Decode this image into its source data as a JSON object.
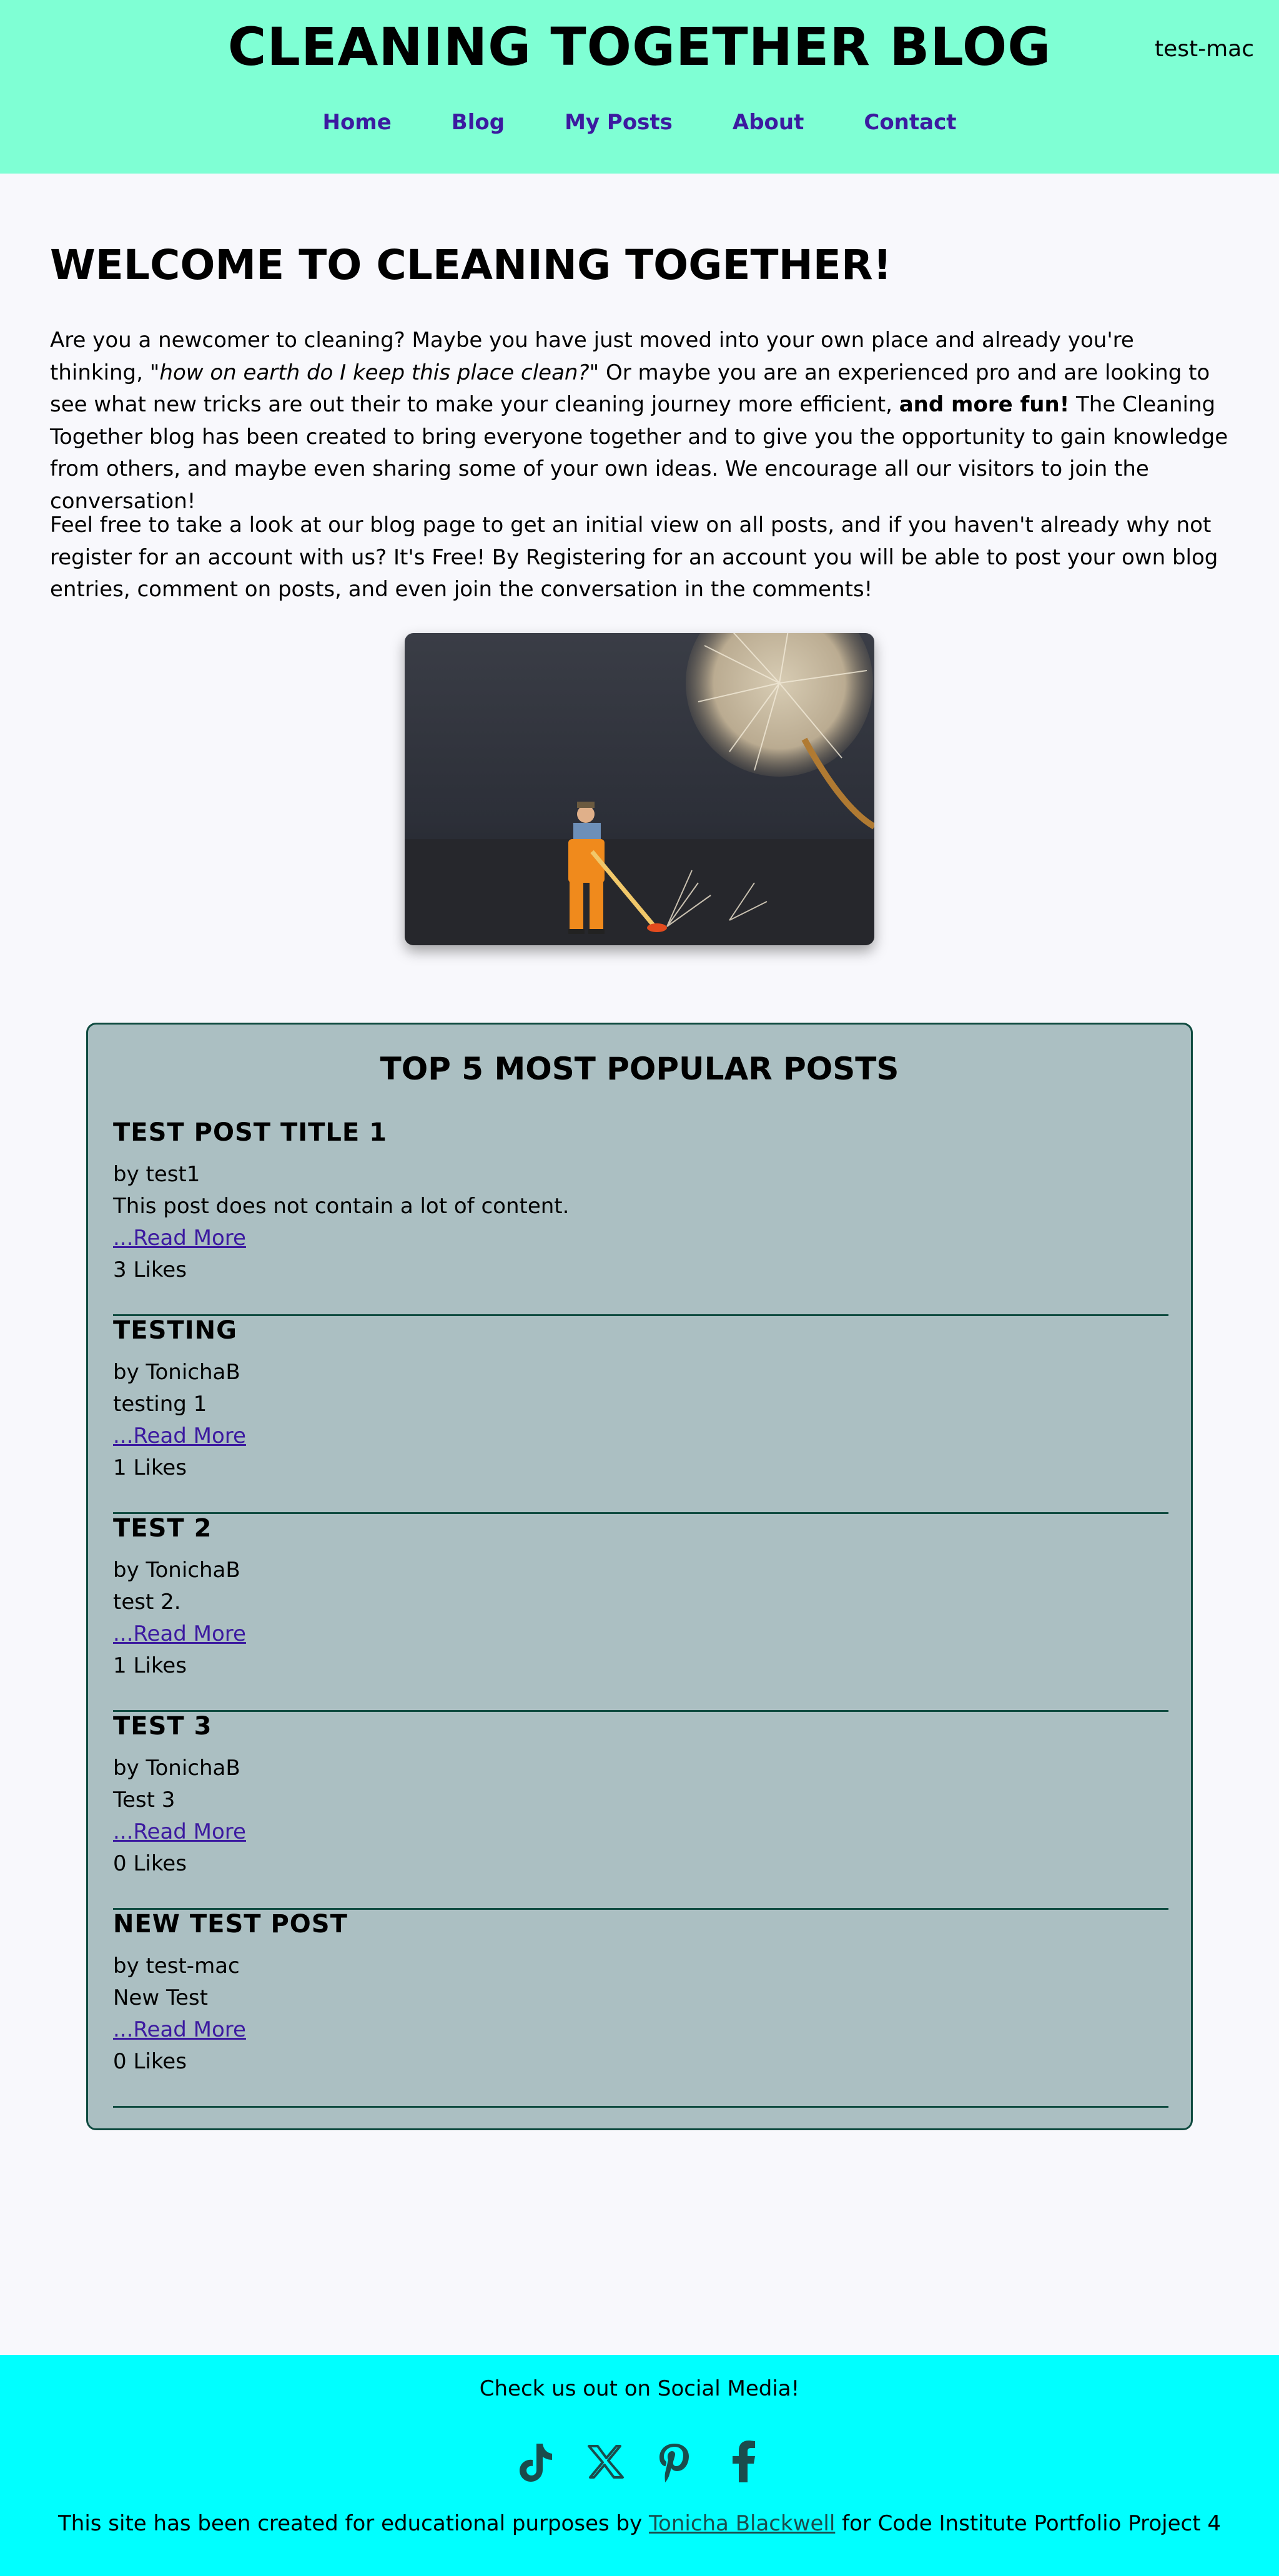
{
  "header": {
    "site_title": "CLEANING TOGETHER BLOG",
    "username": "test-mac",
    "nav": [
      "Home",
      "Blog",
      "My Posts",
      "About",
      "Contact"
    ]
  },
  "welcome": {
    "title": "WELCOME TO CLEANING TOGETHER!",
    "p1_start": "Are you a newcomer to cleaning? Maybe you have just moved into your own place and already you're thinking, ",
    "p1_quote": "\"how on earth do I keep this place clean?\"",
    "p1_mid": " Or maybe you are an experienced pro and are looking to see what new tricks are out their to make your cleaning journey more efficient, ",
    "p1_bold": "and more fun!",
    "p1_end": " The Cleaning Together blog has been created to bring everyone together and to give you the opportunity to gain knowledge from others, and maybe even sharing some of your own ideas. We encourage all our visitors to join the conversation!",
    "p2": "Feel free to take a look at our blog page to get an initial view on all posts, and if you haven't already why not register for an account with us? It's Free! By Registering for an account you will be able to post your own blog entries, comment on posts, and even join the conversation in the comments!"
  },
  "popular": {
    "title": "TOP 5 MOST POPULAR POSTS",
    "posts": [
      {
        "title": "TEST POST TITLE 1",
        "author": "by test1",
        "excerpt": "This post does not contain a lot of content.",
        "read_more": "...Read More",
        "likes": "3 Likes"
      },
      {
        "title": "TESTING",
        "author": "by TonichaB",
        "excerpt": "testing 1",
        "read_more": "...Read More",
        "likes": "1 Likes"
      },
      {
        "title": "TEST 2",
        "author": "by TonichaB",
        "excerpt": "test 2.",
        "read_more": "...Read More",
        "likes": "1 Likes"
      },
      {
        "title": "TEST 3",
        "author": "by TonichaB",
        "excerpt": "Test 3",
        "read_more": "...Read More",
        "likes": "0 Likes"
      },
      {
        "title": "NEW TEST POST",
        "author": "by test-mac",
        "excerpt": "New Test",
        "read_more": "...Read More",
        "likes": "0 Likes"
      }
    ]
  },
  "footer": {
    "tagline": "Check us out on Social Media!",
    "socials": [
      "tiktok-icon",
      "x-icon",
      "pinterest-icon",
      "facebook-icon"
    ],
    "credit_start": "This site has been created for educational purposes by ",
    "credit_link": "Tonicha Blackwell",
    "credit_end": " for Code Institute Portfolio Project 4"
  },
  "colors": {
    "header_bg": "#7fffd4",
    "footer_bg": "#00ffff",
    "popular_bg": "#abbfc2",
    "nav_link": "#3c1aa0",
    "icon": "#1a4c4c"
  }
}
